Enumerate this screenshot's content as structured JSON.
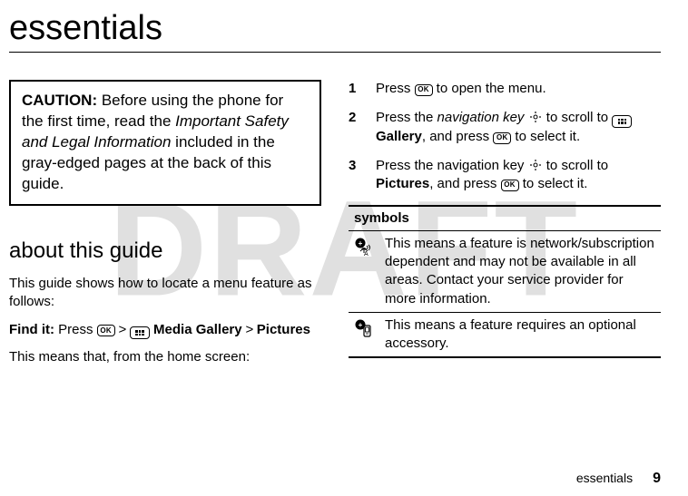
{
  "watermark": "DRAFT",
  "title": "essentials",
  "caution": {
    "label": "CAUTION:",
    "text_pre": " Before using the phone for the first time, read the ",
    "ital": "Important Safety and Legal Information",
    "text_post": " included in the gray-edged pages at the back of this guide."
  },
  "subhead": "about this guide",
  "about_p1": "This guide shows how to locate a menu feature as follows:",
  "findit": {
    "label": "Find it:",
    "press": " Press ",
    "gt1": " > ",
    "media_gallery": " Media Gallery",
    "gt2": " > ",
    "pictures": "Pictures"
  },
  "about_p2": "This means that, from the home screen:",
  "steps": [
    {
      "num": "1",
      "pre": "Press ",
      "post": " to open the menu."
    },
    {
      "num": "2",
      "pre": "Press the ",
      "navkey_label": "navigation key",
      "mid": " to scroll to ",
      "target": " Gallery",
      "press_txt": ", and press ",
      "post": " to select it."
    },
    {
      "num": "3",
      "pre": "Press the navigation key ",
      "mid": " to scroll to ",
      "target": "Pictures",
      "press_txt": ", and press ",
      "post": " to select it."
    }
  ],
  "symbols": {
    "header": "symbols",
    "rows": [
      {
        "icon": "network-icon",
        "text": "This means a feature is network/subscription dependent and may not be available in all areas. Contact your service provider for more information."
      },
      {
        "icon": "accessory-icon",
        "text": "This means a feature requires an optional accessory."
      }
    ]
  },
  "ok_label": "OK",
  "footer": {
    "label": "essentials",
    "page": "9"
  }
}
